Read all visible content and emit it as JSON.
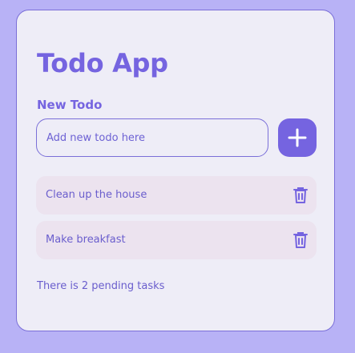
{
  "app": {
    "title": "Todo App",
    "new_todo_label": "New Todo",
    "input": {
      "placeholder": "Add new todo here",
      "value": ""
    },
    "add_icon": "plus-icon",
    "delete_icon": "trash-icon",
    "todos": [
      {
        "text": "Clean up the house"
      },
      {
        "text": "Make breakfast"
      }
    ],
    "pending_text": "There is 2 pending tasks"
  },
  "colors": {
    "page_background": "#b8b2f6",
    "card_background": "#eeedf7",
    "accent": "#7564e0",
    "item_background": "#ece3ef"
  }
}
